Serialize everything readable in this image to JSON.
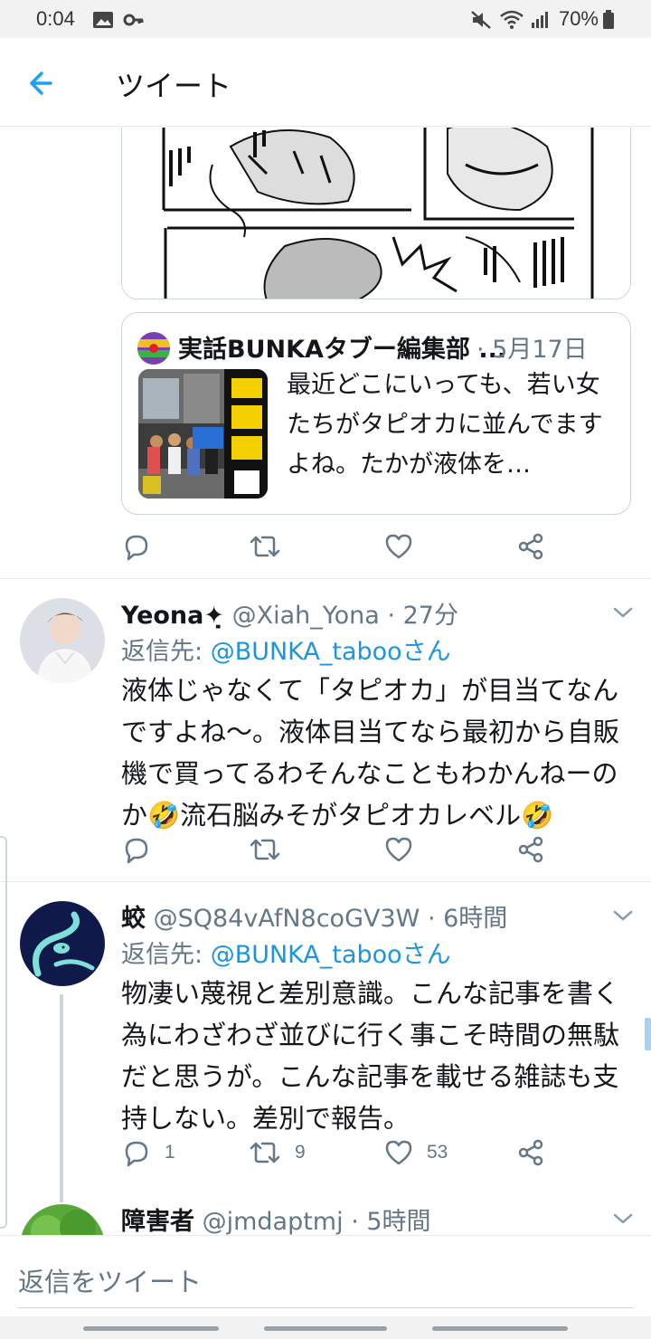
{
  "status_bar": {
    "time": "0:04",
    "battery": "70%"
  },
  "header": {
    "title": "ツイート"
  },
  "quoted_tweet": {
    "name": "実話BUNKAタブー編集部 ...",
    "date": "· 5月17日",
    "text": "最近どこにいっても、若い女たちがタピオカに並んでますよね。たかが液体を…"
  },
  "quoted_actions": {
    "reply": "",
    "retweet": "",
    "like": ""
  },
  "tweets": [
    {
      "name": "Yeona✦̣",
      "handle": "@Xiah_Yona",
      "time": "· 27分",
      "reply_label": "返信先: ",
      "reply_to": "@BUNKA_tabooさん",
      "text": "液体じゃなくて「タピオカ」が目当てなんですよね〜。液体目当てなら最初から自販機で買ってるわそんなこともわかんねーのか🤣流石脳みそがタピオカレベル🤣",
      "reply_count": "",
      "retweet_count": "",
      "like_count": ""
    },
    {
      "name": "蛟",
      "handle": "@SQ84vAfN8coGV3W",
      "time": "· 6時間",
      "reply_label": "返信先: ",
      "reply_to": "@BUNKA_tabooさん",
      "text": "物凄い蔑視と差別意識。こんな記事を書く為にわざわざ並びに行く事こそ時間の無駄だと思うが。こんな記事を載せる雑誌も支持しない。差別で報告。",
      "reply_count": "1",
      "retweet_count": "9",
      "like_count": "53"
    },
    {
      "name": "障害者",
      "handle": "@jmdaptmj",
      "time": "· 5時間"
    }
  ],
  "reply_bar": {
    "placeholder": "返信をツイート"
  },
  "colors": {
    "accent": "#1da1f2",
    "link": "#1b95e0",
    "muted": "#657786",
    "border": "#e6ecf0"
  }
}
